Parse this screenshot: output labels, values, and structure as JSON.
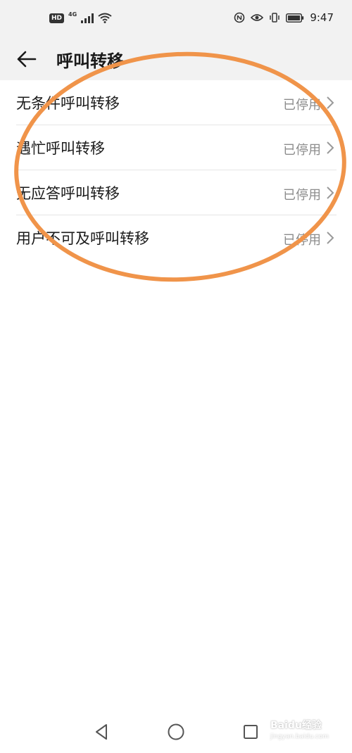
{
  "status_bar": {
    "hd": "HD",
    "network": "4G",
    "time": "9:47",
    "icons": [
      "hd-icon",
      "signal-icon",
      "wifi-icon",
      "nfc-icon",
      "eye-comfort-icon",
      "vibrate-icon",
      "battery-icon"
    ]
  },
  "header": {
    "title": "呼叫转移",
    "back_icon": "back-arrow-icon"
  },
  "forwarding_options": [
    {
      "label": "无条件呼叫转移",
      "status": "已停用"
    },
    {
      "label": "遇忙呼叫转移",
      "status": "已停用"
    },
    {
      "label": "无应答呼叫转移",
      "status": "已停用"
    },
    {
      "label": "用户不可及呼叫转移",
      "status": "已停用"
    }
  ],
  "nav_bar": {
    "icons": [
      "back-triangle-icon",
      "home-circle-icon",
      "recents-square-icon"
    ]
  },
  "watermark": {
    "main": "Baidu经验",
    "sub": "jingyan.baidu.com"
  },
  "colors": {
    "annotation": "#f0944a",
    "header_bg": "#f2f2f2",
    "status_text": "#8c8c8c"
  }
}
